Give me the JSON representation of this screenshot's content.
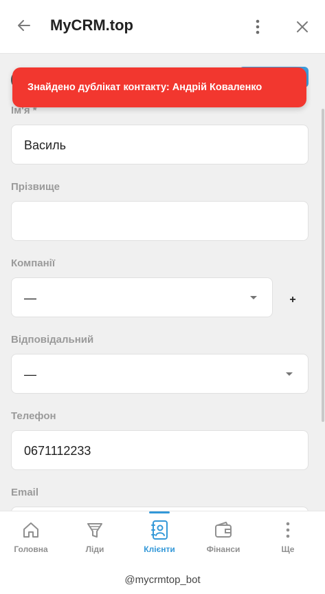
{
  "header": {
    "title": "MyCRM.top",
    "icons": {
      "back": "arrow-left-icon",
      "more": "more-vertical-icon",
      "close": "close-icon"
    }
  },
  "toast": {
    "message": "Знайдено дублікат контакту: Андрій Коваленко",
    "color": "#f2372f"
  },
  "form": {
    "first_name": {
      "label": "Ім'я *",
      "value": "Василь"
    },
    "last_name": {
      "label": "Прізвище",
      "value": ""
    },
    "companies": {
      "label": "Компанії",
      "value": "—",
      "add_label": "+"
    },
    "responsible": {
      "label": "Відповідальний",
      "value": "—"
    },
    "phone": {
      "label": "Телефон",
      "value": "0671112233"
    },
    "email": {
      "label": "Email",
      "value": ""
    }
  },
  "bottom_nav": {
    "items": [
      {
        "label": "Головна",
        "icon": "home-icon"
      },
      {
        "label": "Ліди",
        "icon": "funnel-icon"
      },
      {
        "label": "Клієнти",
        "icon": "contacts-icon",
        "active": true
      },
      {
        "label": "Фінанси",
        "icon": "wallet-icon"
      },
      {
        "label": "Ще",
        "icon": "more-vertical-icon"
      }
    ],
    "active_color": "#3398d8"
  },
  "footer": {
    "handle": "@mycrmtop_bot"
  }
}
